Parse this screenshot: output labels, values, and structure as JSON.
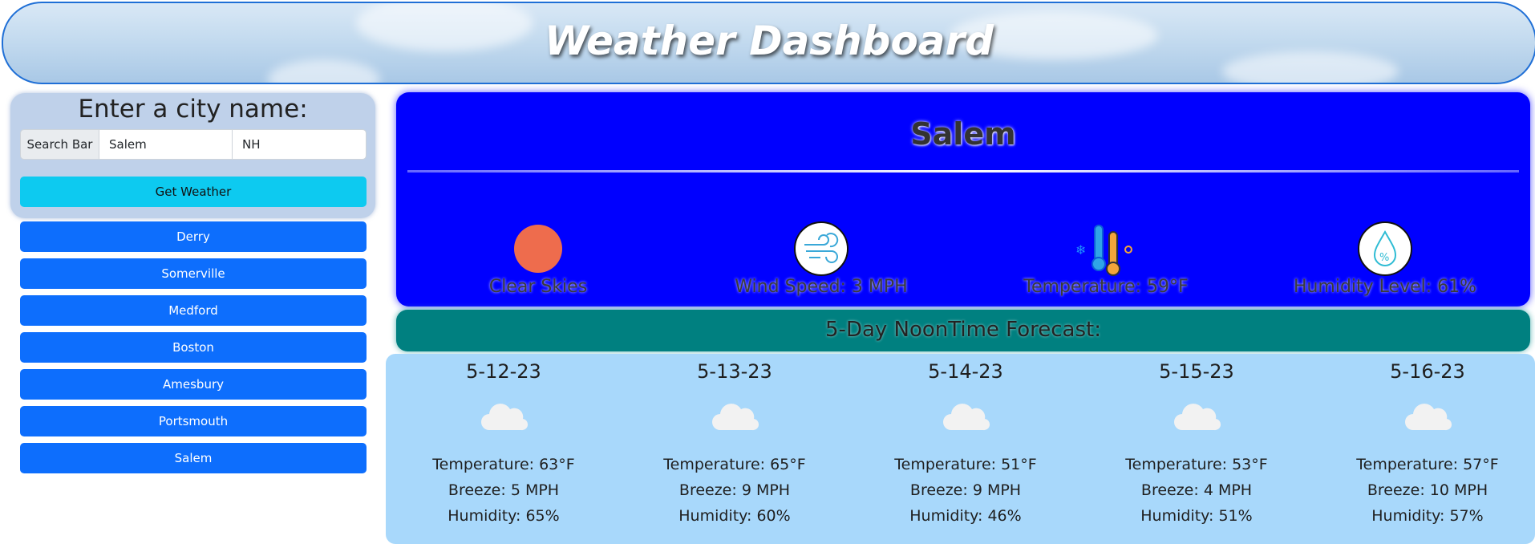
{
  "header": {
    "title": "Weather Dashboard"
  },
  "search": {
    "title": "Enter a city name:",
    "prefix_label": "Search Bar",
    "city_value": "Salem",
    "state_value": "NH",
    "button_label": "Get Weather"
  },
  "history": [
    "Derry",
    "Somerville",
    "Medford",
    "Boston",
    "Amesbury",
    "Portsmouth",
    "Salem"
  ],
  "current": {
    "city": "Salem",
    "condition": "Clear Skies",
    "wind": "Wind Speed: 3 MPH",
    "temperature": "Temperature: 59°F",
    "humidity": "Humidity Level: 61%",
    "icons": [
      "sun-icon",
      "wind-icon",
      "thermometer-icon",
      "humidity-icon"
    ]
  },
  "forecast": {
    "title": "5-Day NoonTime Forecast:",
    "days": [
      {
        "date": "5-12-23",
        "icon": "cloud-icon",
        "temp": "Temperature: 63°F",
        "breeze": "Breeze: 5 MPH",
        "humidity": "Humidity: 65%"
      },
      {
        "date": "5-13-23",
        "icon": "cloud-icon",
        "temp": "Temperature: 65°F",
        "breeze": "Breeze: 9 MPH",
        "humidity": "Humidity: 60%"
      },
      {
        "date": "5-14-23",
        "icon": "cloud-icon",
        "temp": "Temperature: 51°F",
        "breeze": "Breeze: 9 MPH",
        "humidity": "Humidity: 46%"
      },
      {
        "date": "5-15-23",
        "icon": "cloud-icon",
        "temp": "Temperature: 53°F",
        "breeze": "Breeze: 4 MPH",
        "humidity": "Humidity: 51%"
      },
      {
        "date": "5-16-23",
        "icon": "cloud-icon",
        "temp": "Temperature: 57°F",
        "breeze": "Breeze: 10 MPH",
        "humidity": "Humidity: 57%"
      }
    ]
  },
  "colors": {
    "header_border": "#1f6fd6",
    "current_bg": "#0000ff",
    "forecast_bar": "#008080",
    "forecast_panel": "#a8d8fb",
    "city_button": "#0d6efd",
    "get_weather_button": "#0dcaf0"
  }
}
